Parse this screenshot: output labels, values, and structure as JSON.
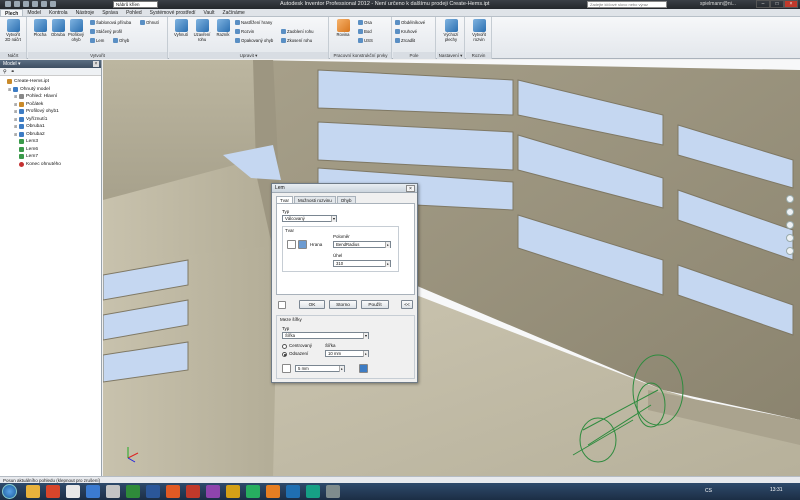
{
  "app": {
    "title": "Autodesk Inventor Professional 2012 - Není určeno k dalšímu prodeji   Create-Hems.ipt",
    "material_combo": "Nábrů kříen",
    "search_placeholder": "Zadejte klíčové slovo nebo výraz",
    "user": "spielmann@ni..."
  },
  "ribbon_tabs": [
    "Plech",
    "Model",
    "Kontrola",
    "Nástroje",
    "Správa",
    "Pohled",
    "Systémové prostředí",
    "Vault",
    "Začínáme"
  ],
  "ribbon": {
    "groups": {
      "nacrt": "Náčrt",
      "vytvorit": "Vytvořit",
      "upravit": "Upravit ▾",
      "pracovni": "Pracovní konstrukční prvky",
      "pole": "Pole",
      "nastaveni": "Nastavení ▾",
      "rozvin": "Rozvin"
    },
    "buttons": {
      "vytvorit_2d": "Vytvořit 2D náčrt",
      "plocha": "Plocha",
      "obruba": "Obruba",
      "profilovy": "Profilový ohyb",
      "sablonova": "Šablonová příruba",
      "staceny": "Stáčený profil",
      "lem": "Lem",
      "ohyb": "Ohyb",
      "ohnuti": "Ohnutí",
      "vyhnuti": "Vyhnutí",
      "uzavreni": "Uzavření rohu",
      "razidlo": "Razník",
      "nastrizeni": "Nastřižení hrany",
      "rozvin_btn": "Rozvin",
      "opakovany": "Opakovaný ohyb",
      "zaobleni": "Zaoblení rohu",
      "zkoseni": "Zkosení rohu",
      "rovina": "Rovina",
      "osa": "Osa",
      "bod": "Bod",
      "uss": "USS",
      "obdelnikove": "Obdélníkové",
      "kruhove": "Kruhové",
      "zrcadlit": "Zrcadlit",
      "vychozi": "Výchozí plechy",
      "vytvorit_rozvin": "Vytvořit rozvin"
    }
  },
  "panel": {
    "title": "Model ▾",
    "tree": [
      {
        "label": "Create-Hems.ipt",
        "icon": "part",
        "indent": 0
      },
      {
        "label": "Ohnutý model",
        "icon": "sheet",
        "indent": 1
      },
      {
        "label": "Pohled: Hlavní",
        "icon": "view",
        "indent": 2
      },
      {
        "label": "Počátek",
        "icon": "origin",
        "indent": 2
      },
      {
        "label": "Profilový ohyb1",
        "icon": "feature",
        "indent": 2
      },
      {
        "label": "Vyříznutí1",
        "icon": "feature",
        "indent": 2
      },
      {
        "label": "Obruba1",
        "icon": "feature",
        "indent": 2
      },
      {
        "label": "Obruba2",
        "icon": "feature",
        "indent": 2
      },
      {
        "label": "Lem3",
        "icon": "hem",
        "indent": 2
      },
      {
        "label": "Lem6",
        "icon": "hem",
        "indent": 2
      },
      {
        "label": "Lem7",
        "icon": "hem",
        "indent": 2
      },
      {
        "label": "Konec ohnutého",
        "icon": "end",
        "indent": 2
      }
    ]
  },
  "dialog": {
    "title": "Lem",
    "tabs": [
      "Tvar",
      "Možnosti rozvinu",
      "Ohyb"
    ],
    "typ_label": "Typ",
    "typ_value": "Válcovaný",
    "tvar_label": "Tvar",
    "hrana_label": "Hrana",
    "polomer_label": "Poloměr",
    "polomer_value": "BendRadius",
    "uhel_label": "Úhel",
    "uhel_value": "310",
    "ok": "OK",
    "storno": "Storno",
    "pouzit": "Použít",
    "more": "<<",
    "meze_label": "Meze šířky",
    "meze_typ_label": "Typ",
    "meze_typ_value": "Šířka",
    "centrovany": "Centrovaný",
    "odsazeni": "Odsazení",
    "sirka_label": "Šířka",
    "sirka_value": "10 mm",
    "odsazeni_value": "5 mm"
  },
  "statusbar": "Posun aktuálního pohledu (klepnout pro zrušení)",
  "taskbar": {
    "lang": "CS",
    "clock": "13:31"
  }
}
